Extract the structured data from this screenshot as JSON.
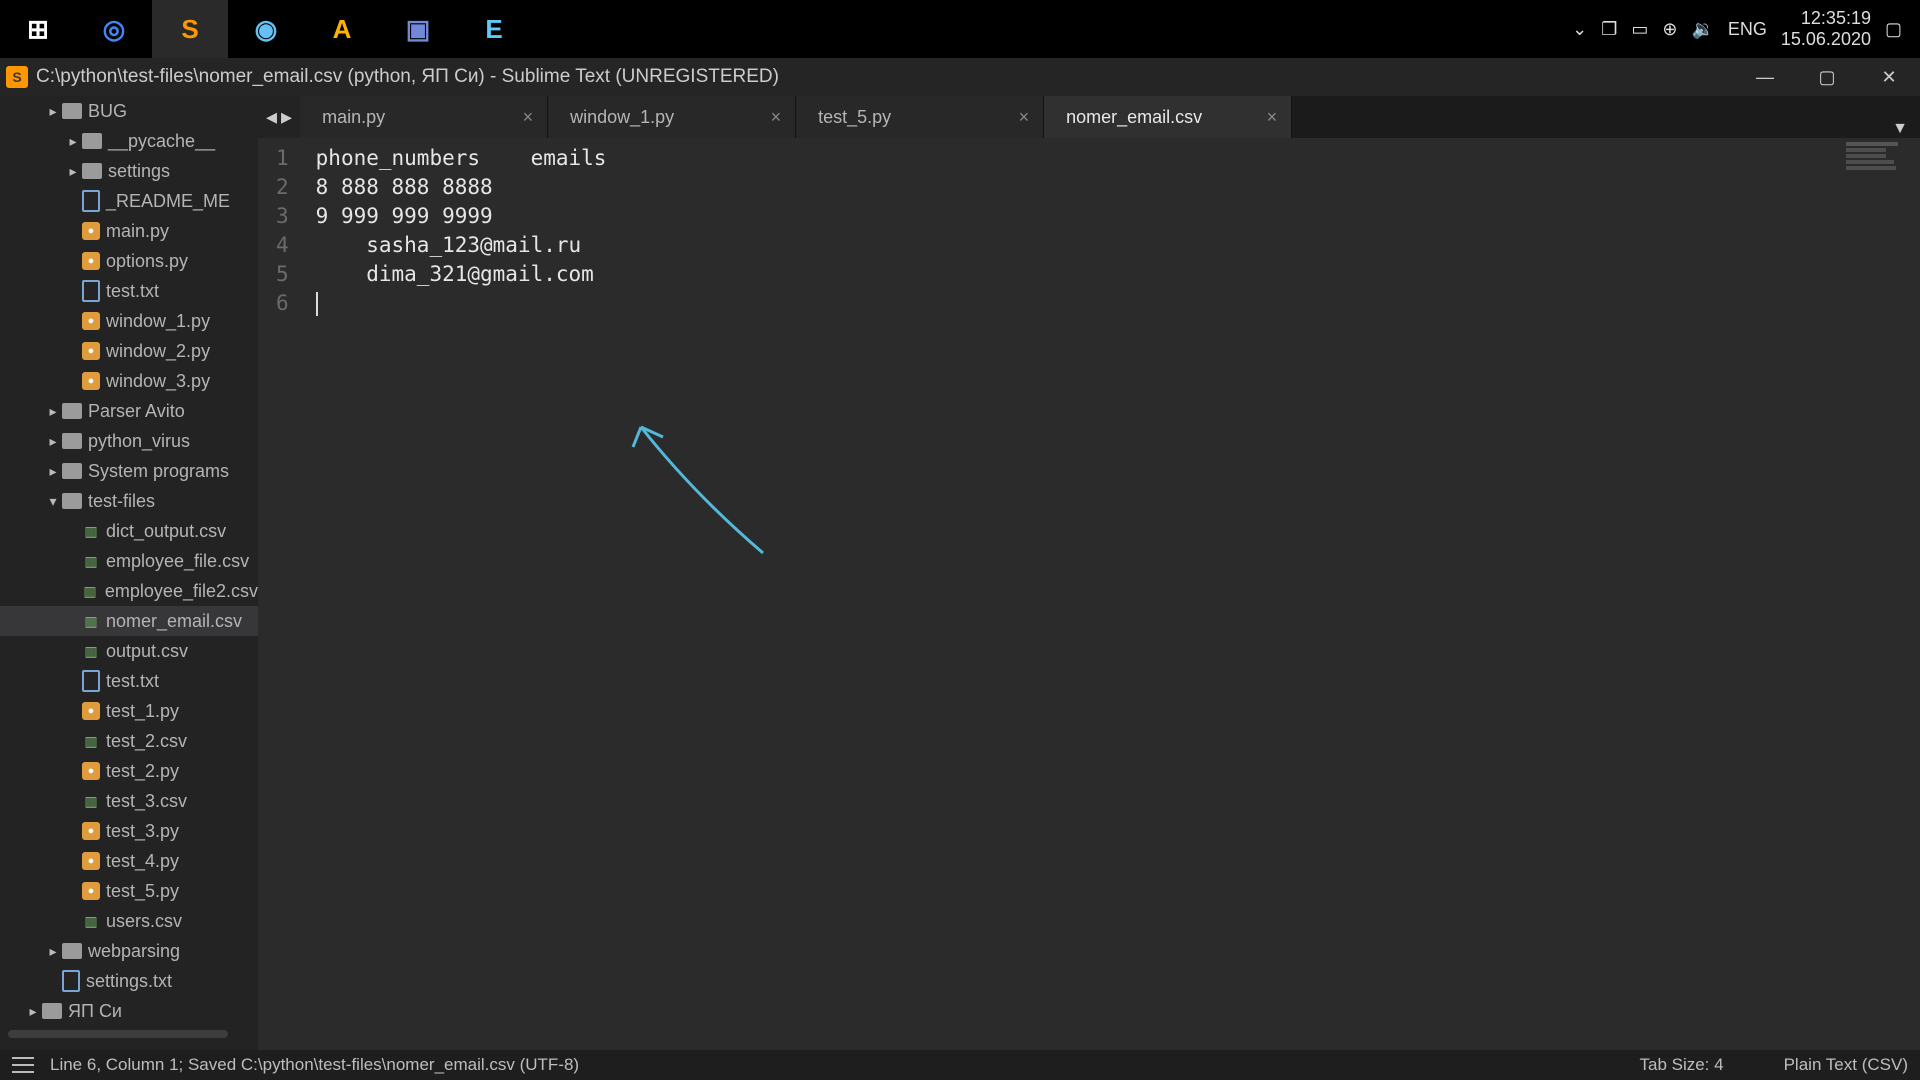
{
  "system": {
    "time": "12:35:19",
    "date": "15.06.2020",
    "lang": "ENG",
    "tray_icons": [
      "chevron-down-icon",
      "notification-icon",
      "battery-icon",
      "network-icon",
      "sound-icon"
    ]
  },
  "taskbar_apps": [
    {
      "name": "start-icon",
      "glyph": "⊞",
      "active": false,
      "color": "#ffffff"
    },
    {
      "name": "chrome-icon",
      "glyph": "◎",
      "active": false,
      "color": "#4285f4"
    },
    {
      "name": "sublime-icon",
      "glyph": "S",
      "active": true,
      "color": "#ff9800"
    },
    {
      "name": "steam-icon",
      "glyph": "◉",
      "active": false,
      "color": "#66c0f4"
    },
    {
      "name": "aimp-icon",
      "glyph": "A",
      "active": false,
      "color": "#ffb300"
    },
    {
      "name": "discord-icon",
      "glyph": "▣",
      "active": false,
      "color": "#7289da"
    },
    {
      "name": "epic-icon",
      "glyph": "E",
      "active": false,
      "color": "#5fc9f8"
    }
  ],
  "window": {
    "title": "C:\\python\\test-files\\nomer_email.csv (python, ЯП Си) - Sublime Text (UNREGISTERED)"
  },
  "sidebar": {
    "items": [
      {
        "indent": 2,
        "type": "folder",
        "label": "BUG",
        "arrow": "▶"
      },
      {
        "indent": 3,
        "type": "folder",
        "label": "__pycache__",
        "arrow": "▶"
      },
      {
        "indent": 3,
        "type": "folder",
        "label": "settings",
        "arrow": "▶"
      },
      {
        "indent": 3,
        "type": "txt",
        "label": "_README_ME"
      },
      {
        "indent": 3,
        "type": "py",
        "label": "main.py"
      },
      {
        "indent": 3,
        "type": "py",
        "label": "options.py"
      },
      {
        "indent": 3,
        "type": "txt",
        "label": "test.txt"
      },
      {
        "indent": 3,
        "type": "py",
        "label": "window_1.py"
      },
      {
        "indent": 3,
        "type": "py",
        "label": "window_2.py"
      },
      {
        "indent": 3,
        "type": "py",
        "label": "window_3.py"
      },
      {
        "indent": 2,
        "type": "folder",
        "label": "Parser Avito",
        "arrow": "▶"
      },
      {
        "indent": 2,
        "type": "folder",
        "label": "python_virus",
        "arrow": "▶"
      },
      {
        "indent": 2,
        "type": "folder",
        "label": "System programs",
        "arrow": "▶"
      },
      {
        "indent": 2,
        "type": "folder",
        "label": "test-files",
        "arrow": "▼"
      },
      {
        "indent": 3,
        "type": "csv",
        "label": "dict_output.csv"
      },
      {
        "indent": 3,
        "type": "csv",
        "label": "employee_file.csv"
      },
      {
        "indent": 3,
        "type": "csv",
        "label": "employee_file2.csv"
      },
      {
        "indent": 3,
        "type": "csv",
        "label": "nomer_email.csv",
        "selected": true
      },
      {
        "indent": 3,
        "type": "csv",
        "label": "output.csv"
      },
      {
        "indent": 3,
        "type": "txt",
        "label": "test.txt"
      },
      {
        "indent": 3,
        "type": "py",
        "label": "test_1.py"
      },
      {
        "indent": 3,
        "type": "csv",
        "label": "test_2.csv"
      },
      {
        "indent": 3,
        "type": "py",
        "label": "test_2.py"
      },
      {
        "indent": 3,
        "type": "csv",
        "label": "test_3.csv"
      },
      {
        "indent": 3,
        "type": "py",
        "label": "test_3.py"
      },
      {
        "indent": 3,
        "type": "py",
        "label": "test_4.py"
      },
      {
        "indent": 3,
        "type": "py",
        "label": "test_5.py"
      },
      {
        "indent": 3,
        "type": "csv",
        "label": "users.csv"
      },
      {
        "indent": 2,
        "type": "folder",
        "label": "webparsing",
        "arrow": "▶"
      },
      {
        "indent": 2,
        "type": "txt",
        "label": "settings.txt"
      },
      {
        "indent": 1,
        "type": "folder",
        "label": "ЯП Си",
        "arrow": "▶"
      }
    ]
  },
  "tabs": [
    {
      "label": "main.py",
      "active": false
    },
    {
      "label": "window_1.py",
      "active": false
    },
    {
      "label": "test_5.py",
      "active": false
    },
    {
      "label": "nomer_email.csv",
      "active": true
    }
  ],
  "editor": {
    "lines": [
      "phone_numbers\temails",
      "8 888 888 8888",
      "9 999 999 9999",
      "\tsasha_123@mail.ru",
      "\tdima_321@gmail.com",
      ""
    ]
  },
  "statusbar": {
    "left": "Line 6, Column 1; Saved C:\\python\\test-files\\nomer_email.csv (UTF-8)",
    "tabsize": "Tab Size: 4",
    "syntax": "Plain Text (CSV)"
  }
}
